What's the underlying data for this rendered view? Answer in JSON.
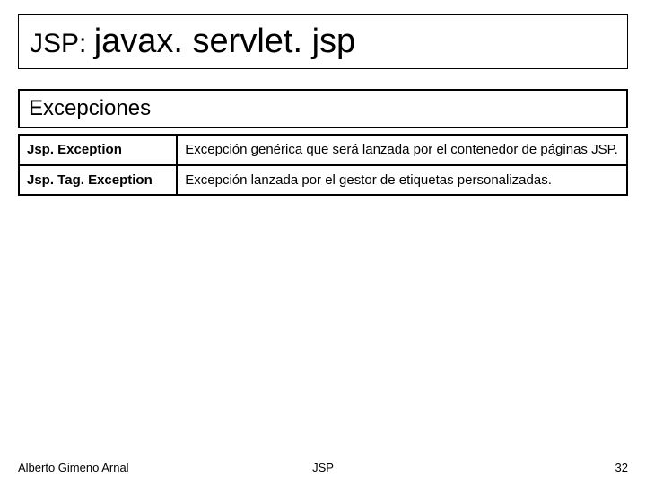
{
  "title": {
    "prefix": "JSP: ",
    "pkg": "javax. servlet. jsp"
  },
  "section": "Excepciones",
  "rows": [
    {
      "name": "Jsp. Exception",
      "desc": "Excepción genérica que será lanzada por el contenedor de páginas JSP.",
      "justify": true
    },
    {
      "name": "Jsp. Tag. Exception",
      "desc": "Excepción lanzada por el gestor de etiquetas personalizadas.",
      "justify": false
    }
  ],
  "footer": {
    "author": "Alberto Gimeno Arnal",
    "topic": "JSP",
    "page": "32"
  }
}
